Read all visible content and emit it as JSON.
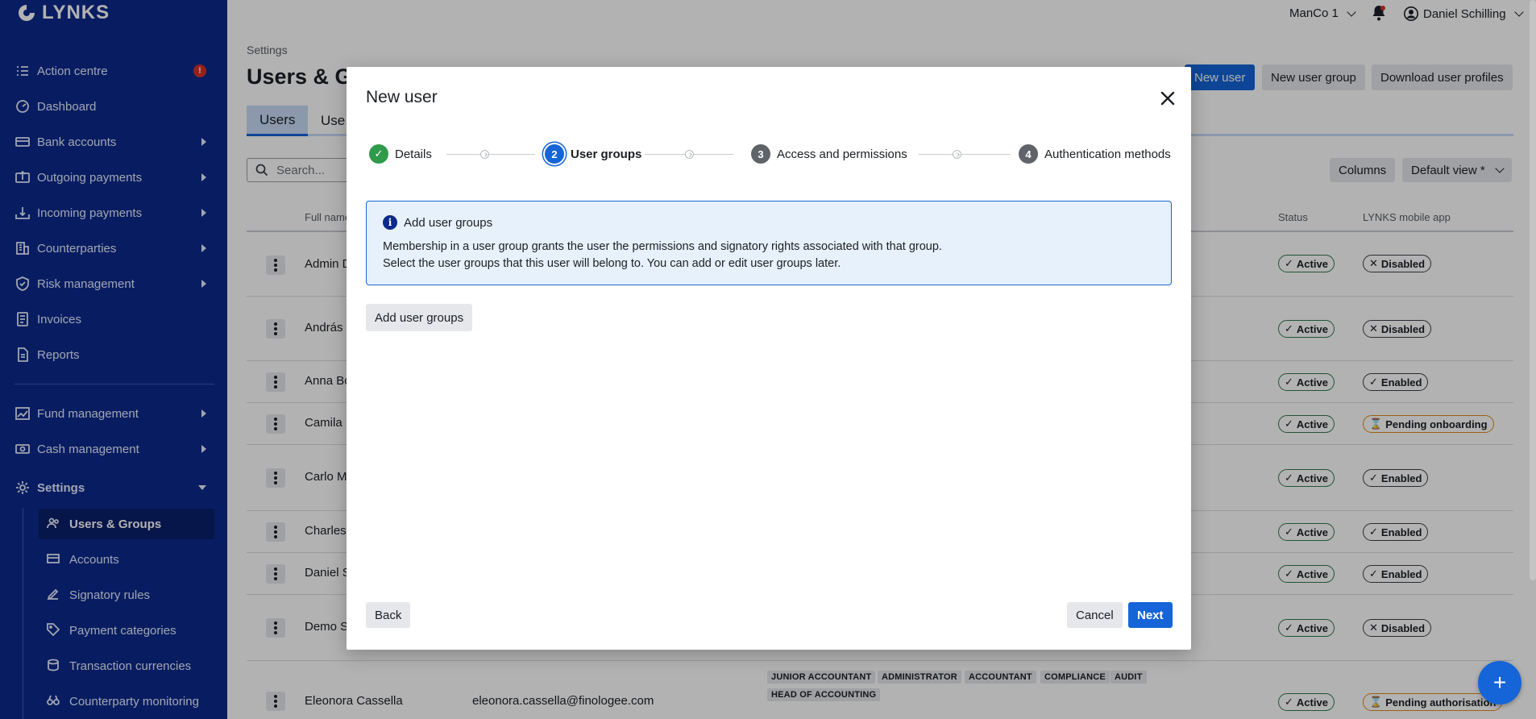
{
  "app": {
    "logo_text": "LYNKS"
  },
  "topbar": {
    "entity": "ManCo 1",
    "user": "Daniel Schilling"
  },
  "sidebar": {
    "items": [
      {
        "label": "Action centre",
        "alert": "!"
      },
      {
        "label": "Dashboard"
      },
      {
        "label": "Bank accounts"
      },
      {
        "label": "Outgoing payments"
      },
      {
        "label": "Incoming payments"
      },
      {
        "label": "Counterparties"
      },
      {
        "label": "Risk management"
      },
      {
        "label": "Invoices"
      },
      {
        "label": "Reports"
      },
      {
        "label": "Fund management"
      },
      {
        "label": "Cash management"
      },
      {
        "label": "Settings"
      }
    ],
    "settings_sub": [
      {
        "label": "Users & Groups"
      },
      {
        "label": "Accounts"
      },
      {
        "label": "Signatory rules"
      },
      {
        "label": "Payment categories"
      },
      {
        "label": "Transaction currencies"
      },
      {
        "label": "Counterparty monitoring"
      }
    ]
  },
  "page": {
    "breadcrumb": "Settings",
    "title": "Users & Gr",
    "actions": {
      "new_user": "New user",
      "new_user_group": "New user group",
      "download": "Download user profiles"
    },
    "tabs": [
      {
        "label": "Users"
      },
      {
        "label": "Use"
      }
    ],
    "search_placeholder": "Search...",
    "columns_btn": "Columns",
    "view_select": "Default view *",
    "table": {
      "headers": {
        "full_name": "Full name",
        "status": "Status",
        "mobile": "LYNKS mobile app"
      },
      "rows": [
        {
          "name": "Admin D",
          "status": "Active",
          "mobile": "Disabled"
        },
        {
          "name": "András",
          "status": "Active",
          "mobile": "Disabled"
        },
        {
          "name": "Anna Bo",
          "status": "Active",
          "mobile": "Enabled"
        },
        {
          "name": "Camila D",
          "status": "Active",
          "mobile": "Pending onboarding"
        },
        {
          "name": "Carlo M",
          "status": "Active",
          "mobile": "Enabled"
        },
        {
          "name": "Charles",
          "status": "Active",
          "mobile": "Enabled"
        },
        {
          "name": "Daniel S",
          "status": "Active",
          "mobile": "Enabled"
        },
        {
          "name": "Demo S",
          "status": "Active",
          "mobile": "Disabled"
        },
        {
          "name": "Eleonora Cassella",
          "email": "eleonora.cassella@finologee.com",
          "status": "Active",
          "mobile": "Pending authorisation",
          "groups": [
            "JUNIOR ACCOUNTANT",
            "ADMINISTRATOR",
            "ACCOUNTANT",
            "COMPLIANCE",
            "AUDIT",
            "HEAD OF ACCOUNTING"
          ]
        }
      ]
    }
  },
  "modal": {
    "title": "New user",
    "steps": [
      {
        "num": "1",
        "label": "Details",
        "state": "done"
      },
      {
        "num": "2",
        "label": "User groups",
        "state": "current"
      },
      {
        "num": "3",
        "label": "Access and permissions",
        "state": "todo"
      },
      {
        "num": "4",
        "label": "Authentication methods",
        "state": "todo"
      }
    ],
    "info": {
      "title": "Add user groups",
      "line1": "Membership in a user group grants the user the permissions and signatory rights associated with that group.",
      "line2": "Select the user groups that this user will belong to. You can add or edit user groups later."
    },
    "add_groups_btn": "Add user groups",
    "back_btn": "Back",
    "cancel_btn": "Cancel",
    "next_btn": "Next"
  },
  "colors": {
    "sidebar": "#0c2a8c",
    "primary": "#1565d8",
    "success": "#2f9a4a",
    "warning": "#e08a18"
  }
}
